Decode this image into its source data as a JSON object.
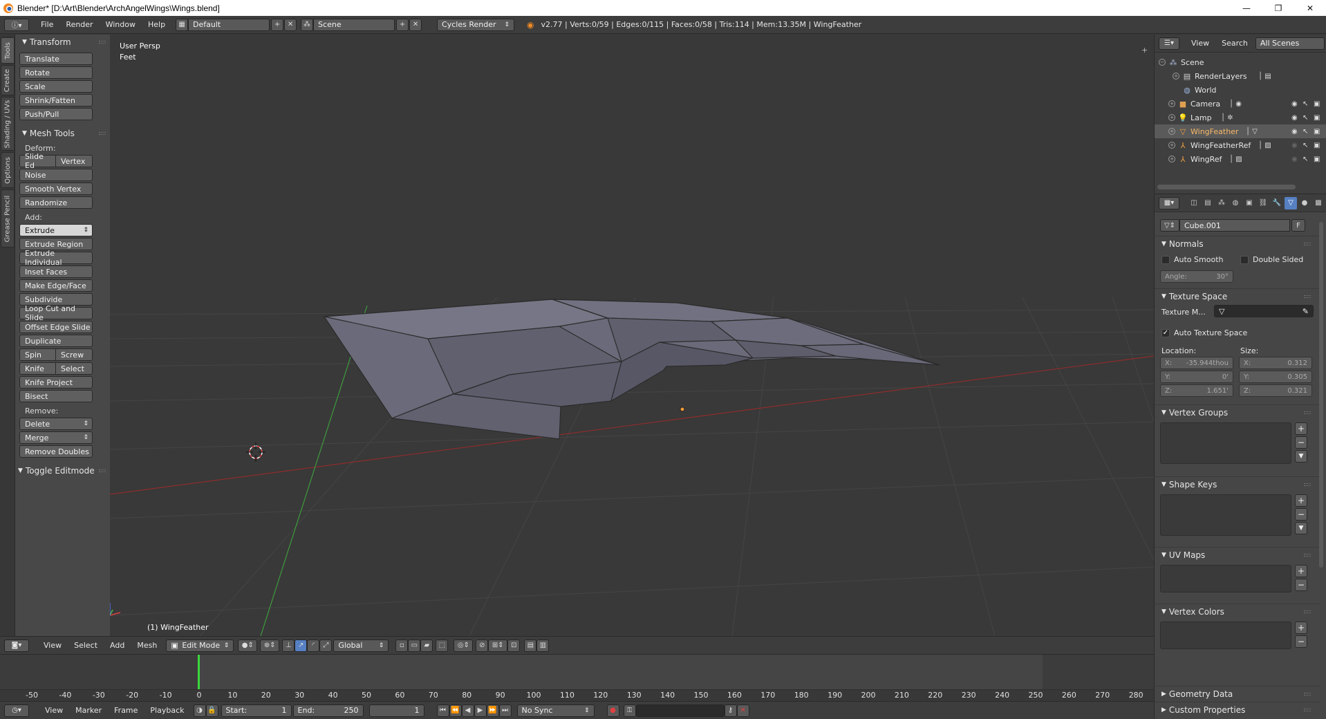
{
  "window": {
    "title": "Blender* [D:\\Art\\Blender\\ArchAngelWings\\Wings.blend]",
    "minimize": "—",
    "maximize": "❐",
    "close": "✕"
  },
  "info_header": {
    "menus": [
      "File",
      "Render",
      "Window",
      "Help"
    ],
    "screen_layout": "Default",
    "scene": "Scene",
    "render_engine": "Cycles Render",
    "stats": "v2.77 | Verts:0/59 | Edges:0/115 | Faces:0/58 | Tris:114 | Mem:13.35M | WingFeather"
  },
  "tool_tabs": [
    "Tools",
    "Create",
    "Shading / UVs",
    "Options",
    "Grease Pencil"
  ],
  "tool_shelf": {
    "transform_title": "Transform",
    "transform": [
      "Translate",
      "Rotate",
      "Scale",
      "Shrink/Fatten",
      "Push/Pull"
    ],
    "mesh_tools_title": "Mesh Tools",
    "deform_label": "Deform:",
    "deform_row": [
      "Slide Ed",
      "Vertex"
    ],
    "deform": [
      "Noise",
      "Smooth Vertex",
      "Randomize"
    ],
    "add_label": "Add:",
    "extrude": "Extrude",
    "add": [
      "Extrude Region",
      "Extrude Individual",
      "Inset Faces",
      "Make Edge/Face",
      "Subdivide",
      "Loop Cut and Slide",
      "Offset Edge Slide",
      "Duplicate"
    ],
    "spin_row": [
      "Spin",
      "Screw"
    ],
    "knife_row": [
      "Knife",
      "Select"
    ],
    "add2": [
      "Knife Project",
      "Bisect"
    ],
    "remove_label": "Remove:",
    "delete": "Delete",
    "merge": "Merge",
    "remove_doubles": "Remove Doubles",
    "toggle_editmode": "Toggle Editmode"
  },
  "viewport": {
    "view_name": "User Persp",
    "units": "Feet",
    "object_label": "(1) WingFeather"
  },
  "view3d_header": {
    "menus": [
      "View",
      "Select",
      "Add",
      "Mesh"
    ],
    "mode": "Edit Mode",
    "orientation": "Global"
  },
  "timeline": {
    "ticks": [
      "-50",
      "-40",
      "-30",
      "-20",
      "-10",
      "0",
      "10",
      "20",
      "30",
      "40",
      "50",
      "60",
      "70",
      "80",
      "90",
      "100",
      "110",
      "120",
      "130",
      "140",
      "150",
      "160",
      "170",
      "180",
      "190",
      "200",
      "210",
      "220",
      "230",
      "240",
      "250",
      "260",
      "270",
      "280"
    ],
    "menus": [
      "View",
      "Marker",
      "Frame",
      "Playback"
    ],
    "start_label": "Start:",
    "start": "1",
    "end_label": "End:",
    "end": "250",
    "current": "1",
    "sync": "No Sync"
  },
  "outliner": {
    "menus": [
      "View",
      "Search"
    ],
    "filter": "All Scenes",
    "items": [
      {
        "name": "Scene",
        "icon": "scene-icon"
      },
      {
        "name": "RenderLayers",
        "icon": "renderlayers-icon"
      },
      {
        "name": "World",
        "icon": "world-icon"
      },
      {
        "name": "Camera",
        "icon": "camera-icon"
      },
      {
        "name": "Lamp",
        "icon": "lamp-icon"
      },
      {
        "name": "WingFeather",
        "icon": "mesh-icon"
      },
      {
        "name": "WingFeatherRef",
        "icon": "empty-icon"
      },
      {
        "name": "WingRef",
        "icon": "empty-icon"
      }
    ]
  },
  "properties": {
    "datablock": "Cube.001",
    "fake_user": "F",
    "normals_title": "Normals",
    "auto_smooth": "Auto Smooth",
    "double_sided": "Double Sided",
    "angle_label": "Angle:",
    "angle": "30°",
    "texture_space_title": "Texture Space",
    "texture_mesh_label": "Texture M...",
    "auto_texture_space": "Auto Texture Space",
    "location_label": "Location:",
    "size_label": "Size:",
    "loc_x_label": "X:",
    "loc_x": "-35.944thou",
    "loc_y_label": "Y:",
    "loc_y": "0'",
    "loc_z_label": "Z:",
    "loc_z": "1.651'",
    "size_x_label": "X:",
    "size_x": "0.312",
    "size_y_label": "Y:",
    "size_y": "0.305",
    "size_z_label": "Z:",
    "size_z": "0.321",
    "vertex_groups_title": "Vertex Groups",
    "shape_keys_title": "Shape Keys",
    "uv_maps_title": "UV Maps",
    "vertex_colors_title": "Vertex Colors",
    "geometry_data_title": "Geometry Data",
    "custom_properties_title": "Custom Properties"
  },
  "colors": {
    "background": "#393939",
    "panel": "#484848",
    "header": "#3d3d3d",
    "active_blue": "#5680c2",
    "x_axis": "#a33333",
    "y_axis": "#3e9b3e",
    "mesh": "#5b5b6a",
    "frame_cursor": "#3bd73b"
  }
}
